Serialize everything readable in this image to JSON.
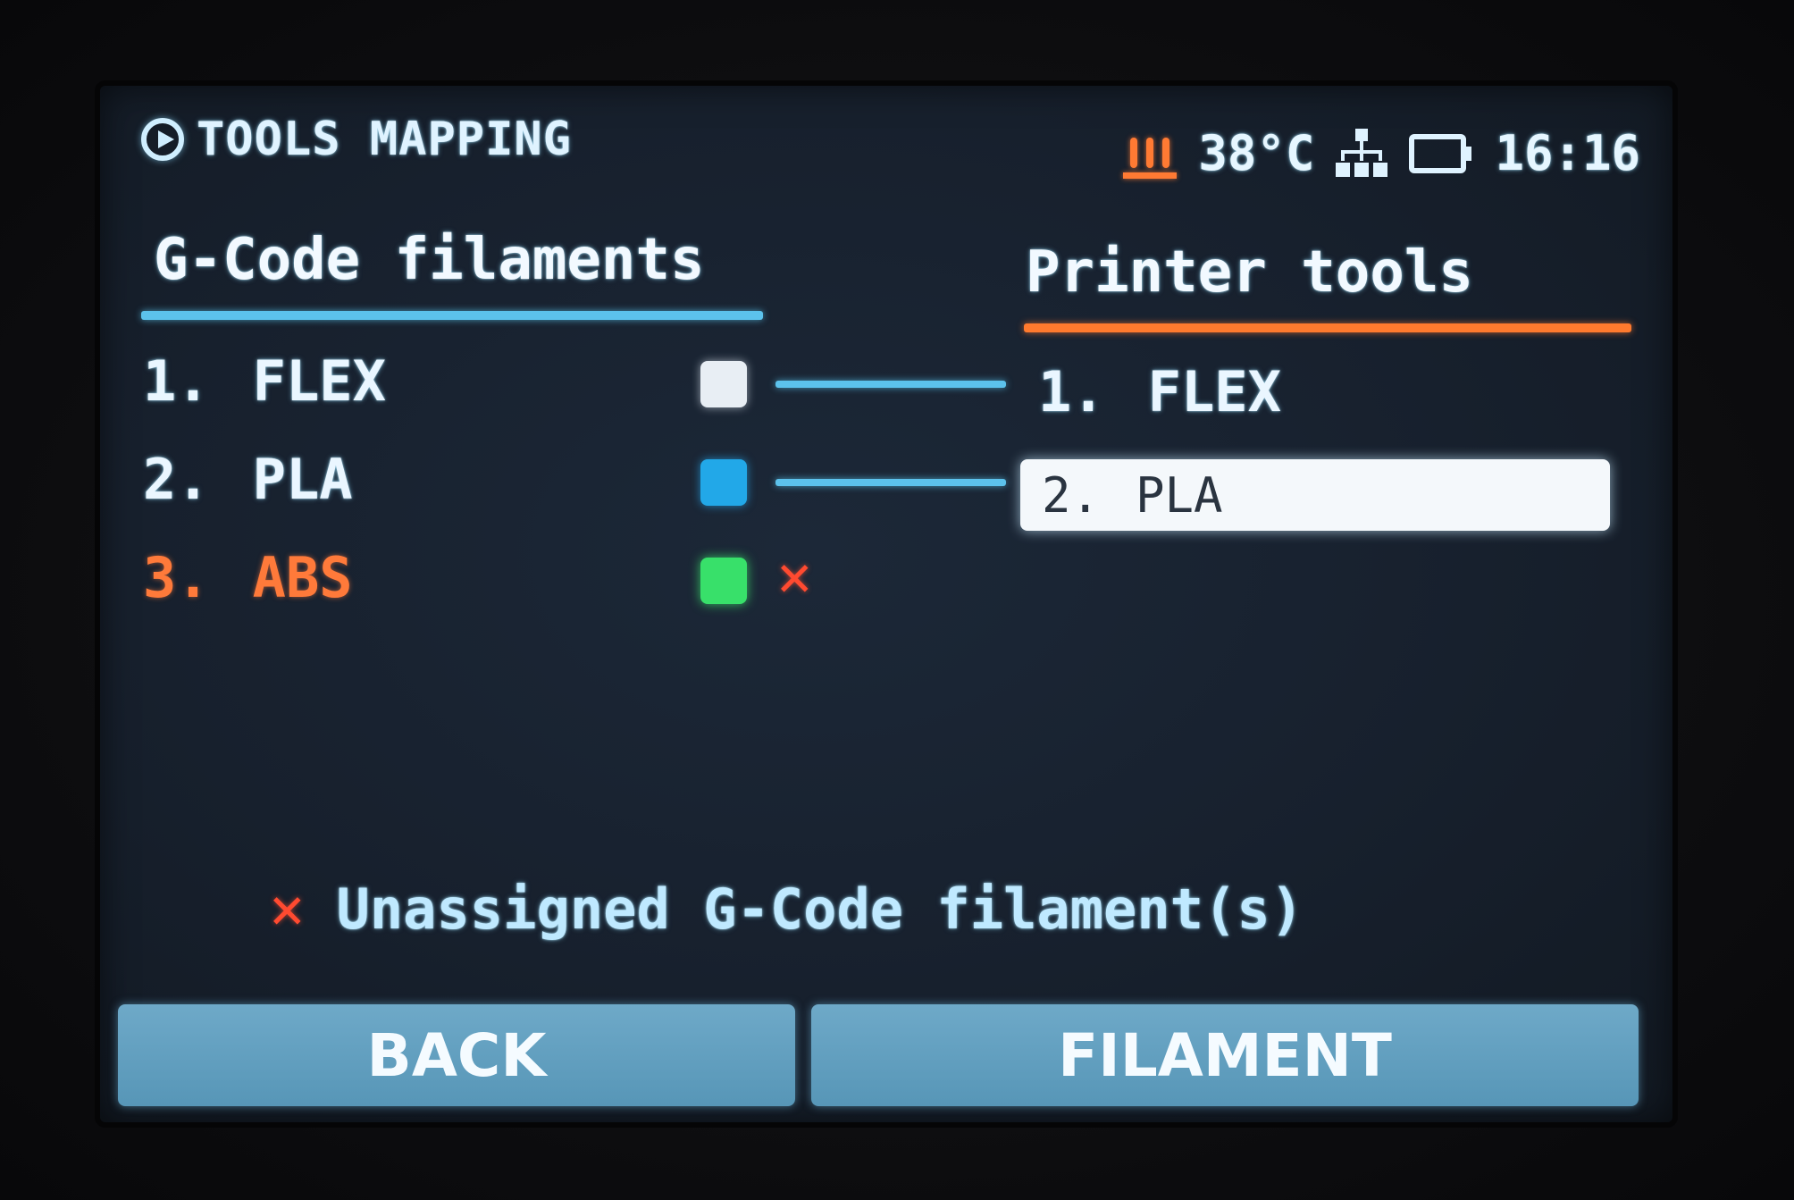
{
  "header": {
    "title": "TOOLS MAPPING",
    "temperature": "38°C",
    "time": "16:16"
  },
  "gcode": {
    "heading": "G-Code filaments",
    "items": [
      {
        "num": "1.",
        "name": "FLEX",
        "color": "#e8eef4",
        "assigned": true
      },
      {
        "num": "2.",
        "name": "PLA",
        "color": "#22a8e8",
        "assigned": true
      },
      {
        "num": "3.",
        "name": "ABS",
        "color": "#38e06a",
        "assigned": false
      }
    ]
  },
  "tools": {
    "heading": "Printer tools",
    "items": [
      {
        "num": "1.",
        "name": "FLEX"
      },
      {
        "num": "2.",
        "name": "PLA",
        "selected": true
      }
    ]
  },
  "warning": {
    "mark": "✕",
    "text": "Unassigned G-Code filament(s)"
  },
  "buttons": {
    "back": "BACK",
    "filament": "FILAMENT"
  },
  "colors": {
    "gcode_accent": "#5cc2ec",
    "tools_accent": "#ff7a2e",
    "error": "#ff4a30"
  }
}
